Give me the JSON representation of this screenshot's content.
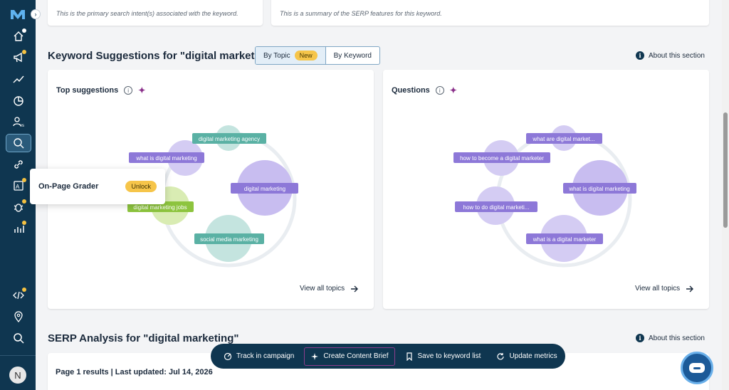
{
  "intent_note": "This is the primary search intent(s) associated with the keyword.",
  "serp_note": "This is a summary of the SERP features for this keyword.",
  "suggestions": {
    "title": "Keyword Suggestions for \"digital marketing\"",
    "toggle": {
      "by_topic": "By Topic",
      "new_badge": "New",
      "by_keyword": "By Keyword"
    },
    "about": "About this section",
    "top": {
      "title": "Top suggestions",
      "topics": [
        "digital marketing agency",
        "what is digital marketing",
        "digital marketing",
        "digital marketing jobs",
        "social media marketing"
      ],
      "view_all": "View all topics"
    },
    "questions": {
      "title": "Questions",
      "topics": [
        "what are digital market...",
        "how to become a digital marketer",
        "what is digital marketing",
        "how to do digital marketi...",
        "what is a digital marketer"
      ],
      "view_all": "View all topics"
    }
  },
  "popup": {
    "title": "On-Page Grader",
    "unlock": "Unlock"
  },
  "serp": {
    "title": "SERP Analysis for \"digital marketing\"",
    "about": "About this section",
    "results": "Page 1 results | Last updated: Jul 14, 2026"
  },
  "actionbar": {
    "track": "Track in campaign",
    "brief": "Create Content Brief",
    "save": "Save to keyword list",
    "update": "Update metrics"
  },
  "user": {
    "avatar_initial": "N"
  },
  "colors": {
    "sidebar": "#0f3650",
    "purple_bubble": "#c8bdf0",
    "teal_bubble": "#c4e4df",
    "green_bubble": "#d9ecb3",
    "badge": "#f6c54a"
  }
}
